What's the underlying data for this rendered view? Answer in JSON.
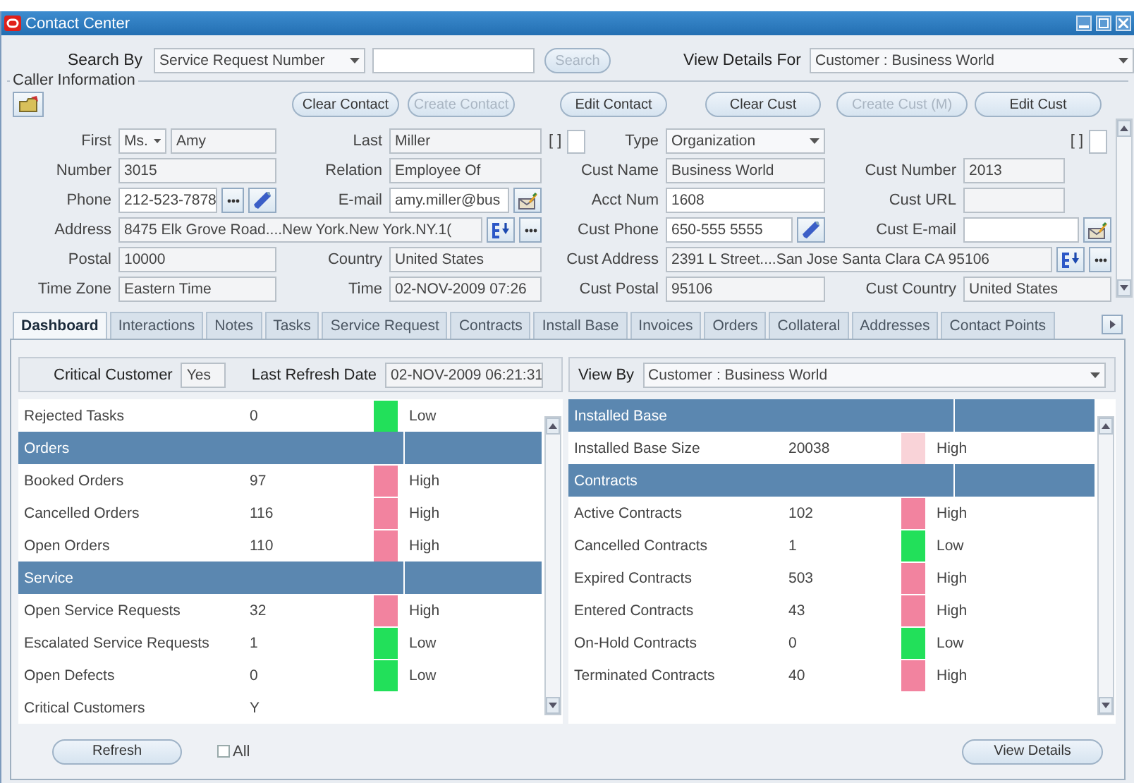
{
  "window": {
    "title": "Contact Center"
  },
  "search": {
    "label": "Search By",
    "by": "Service Request Number",
    "button": {
      "label": "Search",
      "disabled": true
    },
    "details_label": "View Details For",
    "details_for": "Customer : Business World"
  },
  "caller_information": {
    "title": "Caller Information",
    "buttons": [
      {
        "label": "Clear Contact",
        "disabled": false
      },
      {
        "label": "Create Contact",
        "disabled": true
      },
      {
        "label": "Edit Contact",
        "disabled": false
      },
      {
        "label": "Clear Cust",
        "disabled": false
      },
      {
        "label": "Create Cust (M)",
        "disabled": true
      },
      {
        "label": "Edit Cust",
        "disabled": false
      }
    ],
    "rows": [
      {
        "cells": [
          {
            "kind": "label",
            "text": "First"
          },
          {
            "kind": "name",
            "salutation": "Ms.",
            "value": "Amy",
            "editable": false
          },
          {
            "kind": "label",
            "text": "Last"
          },
          {
            "kind": "field",
            "value": "Miller",
            "editable": false
          },
          {
            "kind": "flag_label",
            "bracket": "[ ]",
            "checked": false,
            "text": "Type"
          },
          {
            "kind": "select",
            "value": "Organization"
          },
          {
            "kind": "empty"
          },
          {
            "kind": "flag",
            "bracket": "[ ]",
            "checked": false
          }
        ]
      },
      {
        "cells": [
          {
            "kind": "label",
            "text": "Number"
          },
          {
            "kind": "field",
            "value": "3015",
            "editable": false
          },
          {
            "kind": "label",
            "text": "Relation"
          },
          {
            "kind": "field",
            "value": "Employee Of",
            "editable": false
          },
          {
            "kind": "label",
            "text": "Cust Name"
          },
          {
            "kind": "field",
            "value": "Business World",
            "editable": false
          },
          {
            "kind": "label",
            "text": "Cust Number"
          },
          {
            "kind": "short_field",
            "value": "2013",
            "editable": false
          }
        ]
      },
      {
        "cells": [
          {
            "kind": "label",
            "text": "Phone"
          },
          {
            "kind": "field",
            "value": "212-523-7878",
            "editable": true,
            "buttons": [
              {
                "kind": "more"
              },
              {
                "kind": "phone"
              }
            ]
          },
          {
            "kind": "label",
            "text": "E-mail"
          },
          {
            "kind": "field",
            "value": "amy.miller@bus",
            "editable": true,
            "buttons": [
              {
                "kind": "email"
              }
            ]
          },
          {
            "kind": "label",
            "text": "Acct Num"
          },
          {
            "kind": "field",
            "value": "1608",
            "editable": true
          },
          {
            "kind": "label",
            "text": "Cust URL"
          },
          {
            "kind": "short_field",
            "editable": false
          }
        ]
      },
      {
        "cells": [
          {
            "kind": "label",
            "text": "Address"
          },
          {
            "kind": "wide",
            "value": "8475 Elk Grove Road....New York.New York.NY.1(",
            "editable": false,
            "buttons": [
              {
                "kind": "address"
              },
              {
                "kind": "more"
              }
            ]
          },
          {
            "kind": "covered"
          },
          {
            "kind": "covered"
          },
          {
            "kind": "label",
            "text": "Cust Phone"
          },
          {
            "kind": "field",
            "value": "650-555 5555",
            "editable": true,
            "buttons": [
              {
                "kind": "phone"
              }
            ]
          },
          {
            "kind": "label",
            "text": "Cust E-mail"
          },
          {
            "kind": "field",
            "editable": true,
            "buttons": [
              {
                "kind": "email"
              }
            ]
          }
        ]
      },
      {
        "cells": [
          {
            "kind": "label",
            "text": "Postal"
          },
          {
            "kind": "field",
            "value": "10000",
            "editable": false
          },
          {
            "kind": "label",
            "text": "Country"
          },
          {
            "kind": "field",
            "value": "United States",
            "editable": false
          },
          {
            "kind": "label",
            "text": "Cust Address"
          },
          {
            "kind": "wide",
            "value": "2391 L Street....San Jose Santa Clara CA 95106",
            "editable": false,
            "buttons": [
              {
                "kind": "address"
              },
              {
                "kind": "more"
              }
            ]
          },
          {
            "kind": "covered"
          },
          {
            "kind": "covered"
          }
        ]
      },
      {
        "cells": [
          {
            "kind": "label",
            "text": "Time Zone"
          },
          {
            "kind": "field",
            "value": "Eastern Time",
            "editable": false
          },
          {
            "kind": "label",
            "text": "Time"
          },
          {
            "kind": "field",
            "value": "02-NOV-2009 07:26",
            "editable": false
          },
          {
            "kind": "label",
            "text": "Cust Postal"
          },
          {
            "kind": "field",
            "value": "95106",
            "editable": false
          },
          {
            "kind": "label",
            "text": "Cust Country"
          },
          {
            "kind": "field",
            "value": "United States",
            "editable": false
          }
        ]
      }
    ]
  },
  "tabs": [
    {
      "label": "Dashboard",
      "selected": true
    },
    {
      "label": "Interactions",
      "selected": false
    },
    {
      "label": "Notes",
      "selected": false
    },
    {
      "label": "Tasks",
      "selected": false
    },
    {
      "label": "Service Request",
      "selected": false
    },
    {
      "label": "Contracts",
      "selected": false
    },
    {
      "label": "Install Base",
      "selected": false
    },
    {
      "label": "Invoices",
      "selected": false
    },
    {
      "label": "Orders",
      "selected": false
    },
    {
      "label": "Collateral",
      "selected": false
    },
    {
      "label": "Addresses",
      "selected": false
    },
    {
      "label": "Contact Points",
      "selected": false
    }
  ],
  "dashboard": {
    "critical_label": "Critical Customer",
    "critical": "Yes",
    "refresh_label": "Last Refresh Date",
    "refresh": "02-NOV-2009 06:21:31",
    "view_by_label": "View By",
    "view_by": "Customer : Business World",
    "left_table": [
      {
        "kind": "metric",
        "label": "Rejected Tasks",
        "value": "0",
        "color": "#22e05a",
        "rating": "Low"
      },
      {
        "kind": "section",
        "label": "Orders"
      },
      {
        "kind": "metric",
        "label": "Booked Orders",
        "value": "97",
        "color": "#f2839f",
        "rating": "High"
      },
      {
        "kind": "metric",
        "label": "Cancelled Orders",
        "value": "116",
        "color": "#f2839f",
        "rating": "High"
      },
      {
        "kind": "metric",
        "label": "Open Orders",
        "value": "110",
        "color": "#f2839f",
        "rating": "High"
      },
      {
        "kind": "section",
        "label": "Service"
      },
      {
        "kind": "metric",
        "label": "Open Service Requests",
        "value": "32",
        "color": "#f2839f",
        "rating": "High"
      },
      {
        "kind": "metric",
        "label": "Escalated Service Requests",
        "value": "1",
        "color": "#22e05a",
        "rating": "Low"
      },
      {
        "kind": "metric",
        "label": "Open Defects",
        "value": "0",
        "color": "#22e05a",
        "rating": "Low"
      },
      {
        "kind": "metric",
        "label": "Critical Customers",
        "value": "Y"
      }
    ],
    "right_table": [
      {
        "kind": "section",
        "label": "Installed Base"
      },
      {
        "kind": "metric",
        "label": "Installed Base Size",
        "value": "20038",
        "color": "#f9d3d8",
        "rating": "High"
      },
      {
        "kind": "section",
        "label": "Contracts"
      },
      {
        "kind": "metric",
        "label": "Active Contracts",
        "value": "102",
        "color": "#f2839f",
        "rating": "High"
      },
      {
        "kind": "metric",
        "label": "Cancelled Contracts",
        "value": "1",
        "color": "#22e05a",
        "rating": "Low"
      },
      {
        "kind": "metric",
        "label": "Expired Contracts",
        "value": "503",
        "color": "#f2839f",
        "rating": "High"
      },
      {
        "kind": "metric",
        "label": "Entered Contracts",
        "value": "43",
        "color": "#f2839f",
        "rating": "High"
      },
      {
        "kind": "metric",
        "label": "On-Hold Contracts",
        "value": "0",
        "color": "#22e05a",
        "rating": "Low"
      },
      {
        "kind": "metric",
        "label": "Terminated Contracts",
        "value": "40",
        "color": "#f2839f",
        "rating": "High"
      }
    ],
    "refresh_button": "Refresh",
    "all": {
      "label": "All",
      "checked": false
    },
    "details_button": "View Details"
  }
}
